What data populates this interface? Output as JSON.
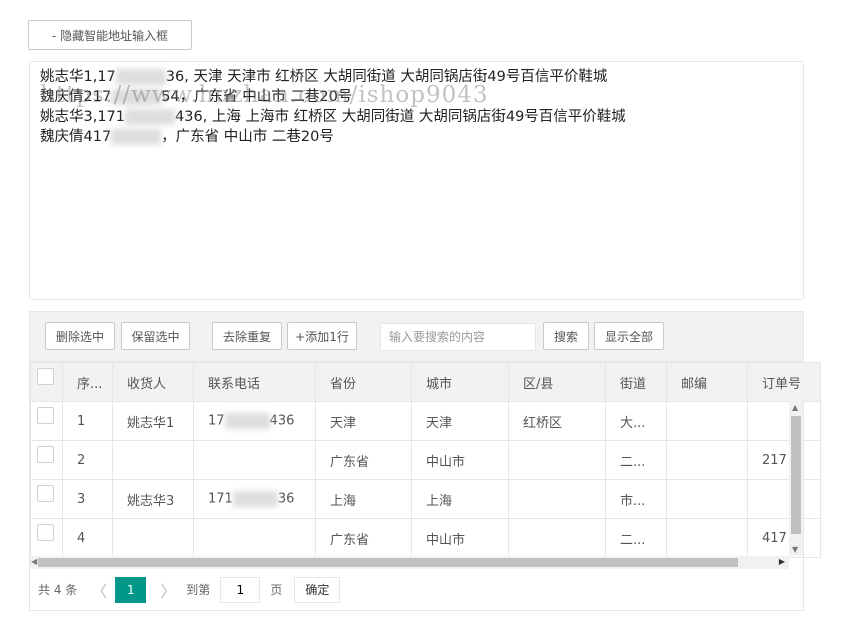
{
  "toggle_button": "- 隐藏智能地址输入框",
  "textarea_lines": [
    {
      "pre": "姚志华1,17",
      "post": "36, 天津 天津市 红桥区 大胡同街道 大胡同锅店街49号百信平价鞋城"
    },
    {
      "pre": "魏庆倩217",
      "post": "54，广东省 中山市 二巷20号"
    },
    {
      "pre": "姚志华3,171",
      "post": "436, 上海 上海市 红桥区 大胡同街道 大胡同锅店街49号百信平价鞋城"
    },
    {
      "pre": "魏庆倩417",
      "post": "，广东省 中山市  二巷20号"
    }
  ],
  "watermark": "https://www.huzhan.com/ishop9043",
  "toolbar": {
    "delete_selected": "删除选中",
    "keep_selected": "保留选中",
    "dedupe": "去除重复",
    "add_row": "+添加1行",
    "search_placeholder": "输入要搜索的内容",
    "search": "搜索",
    "show_all": "显示全部"
  },
  "columns": [
    "序...",
    "收货人",
    "联系电话",
    "省份",
    "城市",
    "区/县",
    "街道",
    "邮编",
    "订单号"
  ],
  "rows": [
    {
      "no": "1",
      "name": "姚志华1",
      "phone_pre": "17",
      "phone_post": "436",
      "province": "天津",
      "city": "天津",
      "district": "红桥区",
      "street": "大...",
      "zip": "",
      "order": ""
    },
    {
      "no": "2",
      "name": "",
      "phone_pre": "",
      "phone_post": "",
      "province": "广东省",
      "city": "中山市",
      "district": "",
      "street": "二...",
      "zip": "",
      "order": "217"
    },
    {
      "no": "3",
      "name": "姚志华3",
      "phone_pre": "171",
      "phone_post": "36",
      "province": "上海",
      "city": "上海",
      "district": "",
      "street": "市...",
      "zip": "",
      "order": ""
    },
    {
      "no": "4",
      "name": "",
      "phone_pre": "",
      "phone_post": "",
      "province": "广东省",
      "city": "中山市",
      "district": "",
      "street": "二...",
      "zip": "",
      "order": "417"
    }
  ],
  "pagination": {
    "total": "共 4 条",
    "current": "1",
    "goto": "到第",
    "page_value": "1",
    "page_unit": "页",
    "confirm": "确定"
  },
  "colors": {
    "accent": "#009688"
  }
}
